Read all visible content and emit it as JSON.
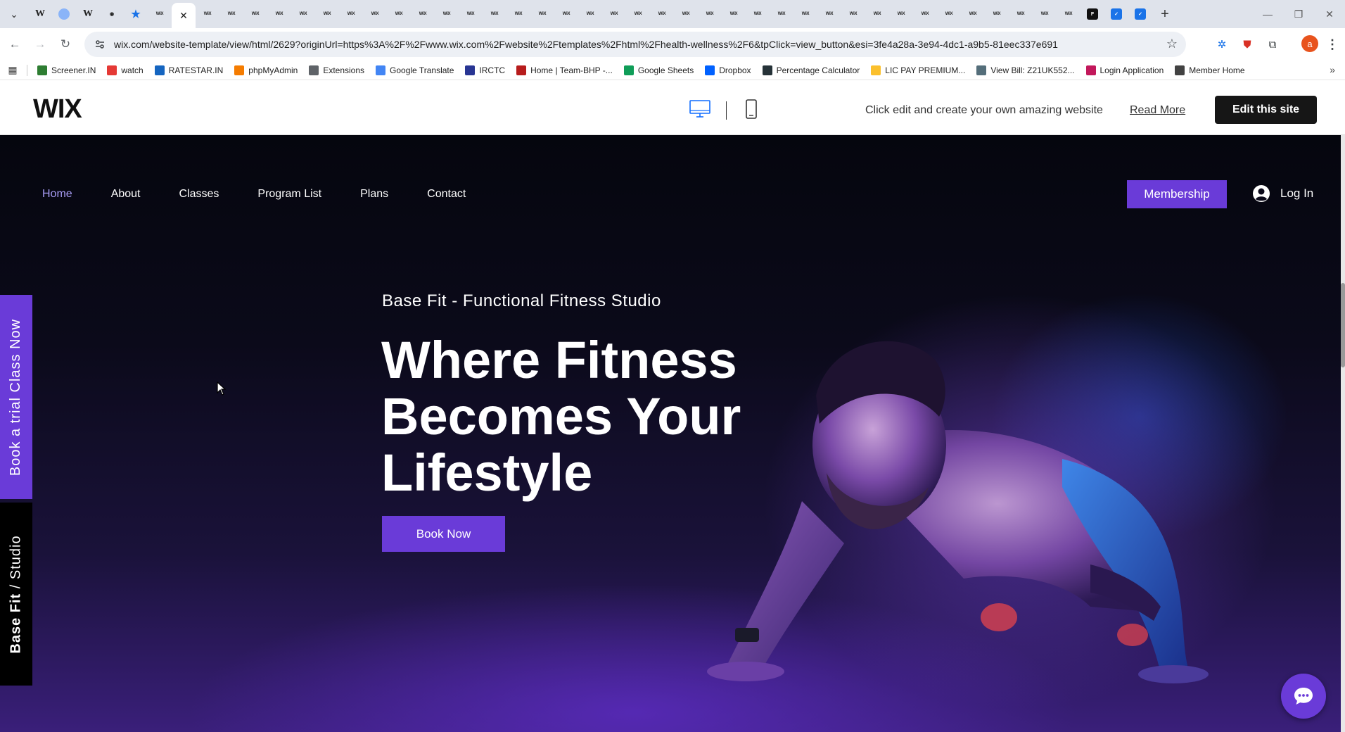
{
  "browser": {
    "url": "wix.com/website-template/view/html/2629?originUrl=https%3A%2F%2Fwww.wix.com%2Fwebsite%2Ftemplates%2Fhtml%2Fhealth-wellness%2F6&tpClick=view_button&esi=3fe4a28a-3e94-4dc1-a9b5-81eec337e691",
    "profile_initial": "a",
    "bookmarks": [
      {
        "label": "Screener.IN",
        "color": "#2e7d32"
      },
      {
        "label": "watch",
        "color": "#e53935"
      },
      {
        "label": "RATESTAR.IN",
        "color": "#1565c0"
      },
      {
        "label": "phpMyAdmin",
        "color": "#f57c00"
      },
      {
        "label": "Extensions",
        "color": "#5f6368"
      },
      {
        "label": "Google Translate",
        "color": "#4285f4"
      },
      {
        "label": "IRCTC",
        "color": "#283593"
      },
      {
        "label": "Home | Team-BHP -...",
        "color": "#b71c1c"
      },
      {
        "label": "Google Sheets",
        "color": "#0f9d58"
      },
      {
        "label": "Dropbox",
        "color": "#0061ff"
      },
      {
        "label": "Percentage Calculator",
        "color": "#263238"
      },
      {
        "label": "LIC PAY PREMIUM...",
        "color": "#fbc02d"
      },
      {
        "label": "View Bill: Z21UK552...",
        "color": "#546e7a"
      },
      {
        "label": "Login Application",
        "color": "#c2185b"
      },
      {
        "label": "Member Home",
        "color": "#424242"
      }
    ]
  },
  "wix_bar": {
    "logo": "WIX",
    "message": "Click edit and create your own amazing website",
    "read_more": "Read More",
    "edit_button": "Edit this site"
  },
  "site": {
    "nav": [
      "Home",
      "About",
      "Classes",
      "Program List",
      "Plans",
      "Contact"
    ],
    "membership": "Membership",
    "login": "Log In",
    "side_trial": "Book a trial Class Now",
    "side_brand_bold": "Base Fit",
    "side_brand_rest": " / Studio",
    "eyebrow": "Base Fit - Functional Fitness Studio",
    "headline": "Where Fitness Becomes Your Lifestyle",
    "cta": "Book Now"
  },
  "colors": {
    "accent": "#6a3bd8",
    "nav_active": "#a89cf5"
  }
}
